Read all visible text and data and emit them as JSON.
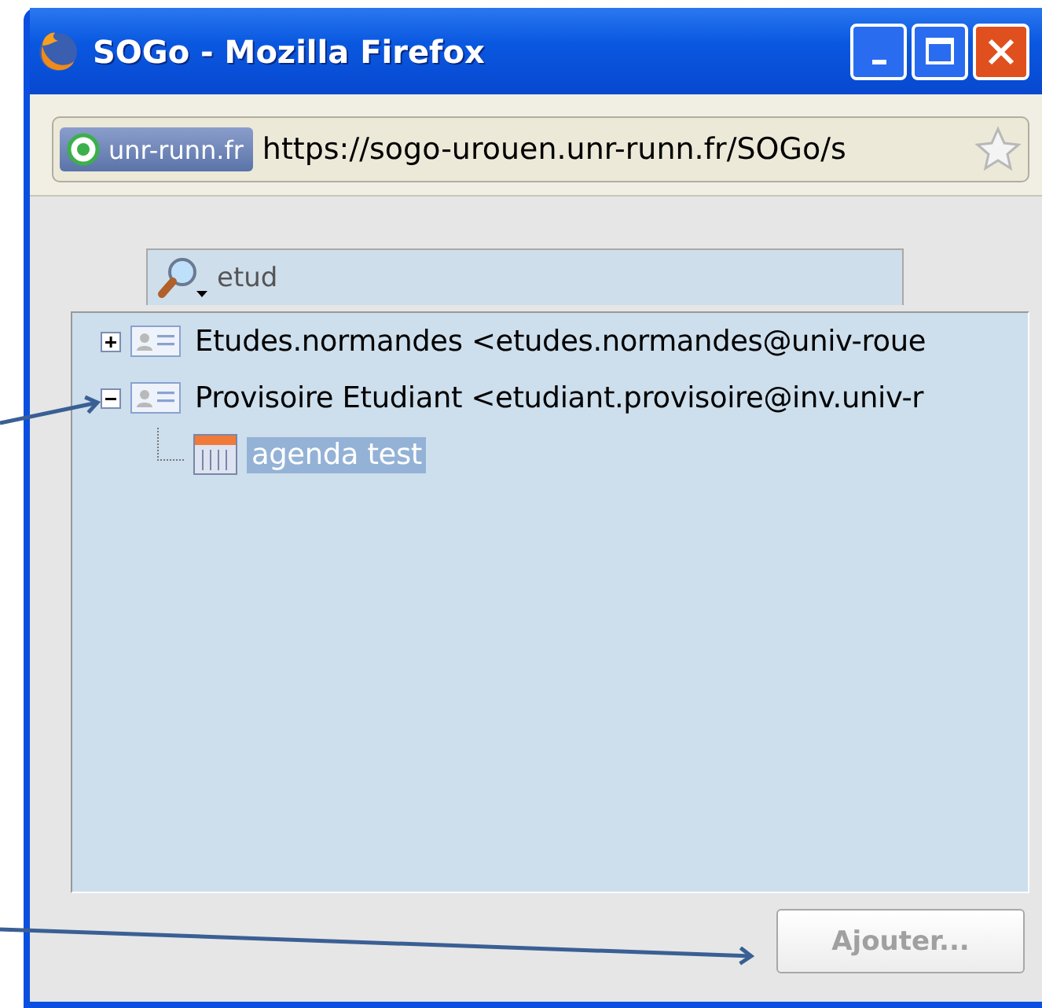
{
  "window": {
    "title": "SOGo - Mozilla Firefox"
  },
  "address_bar": {
    "site_badge": "unr-runn.fr",
    "url": "https://sogo-urouen.unr-runn.fr/SOGo/s",
    "bookmarked": false
  },
  "search": {
    "value": "etud"
  },
  "tree": [
    {
      "kind": "contact",
      "label": "Etudes.normandes <etudes.normandes@univ-roue",
      "expanded": false,
      "selected": false
    },
    {
      "kind": "contact",
      "label": "Provisoire Etudiant <etudiant.provisoire@inv.univ-r",
      "expanded": true,
      "selected": false,
      "children": [
        {
          "kind": "calendar",
          "label": "agenda test",
          "selected": true
        }
      ]
    }
  ],
  "add_button": {
    "label": "Ajouter...",
    "disabled": true
  }
}
